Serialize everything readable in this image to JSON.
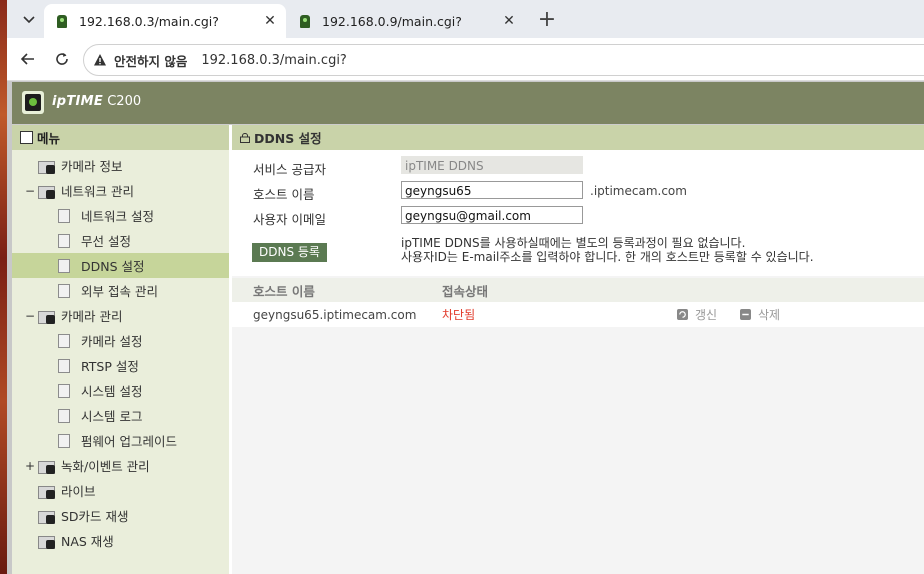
{
  "browser": {
    "tabs": [
      {
        "title": "192.168.0.3/main.cgi?",
        "active": true
      },
      {
        "title": "192.168.0.9/main.cgi?",
        "active": false
      }
    ],
    "security_label": "안전하지 않음",
    "url": "192.168.0.3/main.cgi?"
  },
  "header": {
    "brand": "ipTIME",
    "model": "C200"
  },
  "sidebar": {
    "title": "메뉴",
    "items": [
      {
        "label": "카메라 정보",
        "level": 0
      },
      {
        "label": "네트워크 관리",
        "level": 0,
        "toggle": "−"
      },
      {
        "label": "네트워크 설정",
        "level": 1
      },
      {
        "label": "무선 설정",
        "level": 1
      },
      {
        "label": "DDNS 설정",
        "level": 1,
        "selected": true
      },
      {
        "label": "외부 접속 관리",
        "level": 1
      },
      {
        "label": "카메라 관리",
        "level": 0,
        "toggle": "−"
      },
      {
        "label": "카메라 설정",
        "level": 1
      },
      {
        "label": "RTSP 설정",
        "level": 1
      },
      {
        "label": "시스템 설정",
        "level": 1
      },
      {
        "label": "시스템 로그",
        "level": 1
      },
      {
        "label": "펌웨어 업그레이드",
        "level": 1
      },
      {
        "label": "녹화/이벤트 관리",
        "level": 0,
        "toggle": "+"
      },
      {
        "label": "라이브",
        "level": 0
      },
      {
        "label": "SD카드 재생",
        "level": 0
      },
      {
        "label": "NAS 재생",
        "level": 0
      }
    ]
  },
  "ddns": {
    "title": "DDNS 설정",
    "provider_label": "서비스 공급자",
    "provider_value": "ipTIME DDNS",
    "host_label": "호스트 이름",
    "host_value": "geyngsu65",
    "host_suffix": ".iptimecam.com",
    "email_label": "사용자 이메일",
    "email_value": "geyngsu@gmail.com",
    "register_button": "DDNS 등록",
    "notice_line1": "ipTIME DDNS를 사용하실때에는 별도의 등록과정이 필요 없습니다.",
    "notice_line2": "사용자ID는 E-mail주소를 입력하야 합니다. 한 개의 호스트만 등록할 수 있습니다."
  },
  "table": {
    "headers": [
      "호스트 이름",
      "접속상태"
    ],
    "rows": [
      {
        "host": "geyngsu65.iptimecam.com",
        "status": "차단됨",
        "refresh": "갱신",
        "delete": "삭제"
      }
    ]
  },
  "colors": {
    "status_blocked": "#e23a2a",
    "brand_bar": "#7c8462",
    "menu_header": "#c9d3a9",
    "selected_item": "#c6d59a"
  }
}
